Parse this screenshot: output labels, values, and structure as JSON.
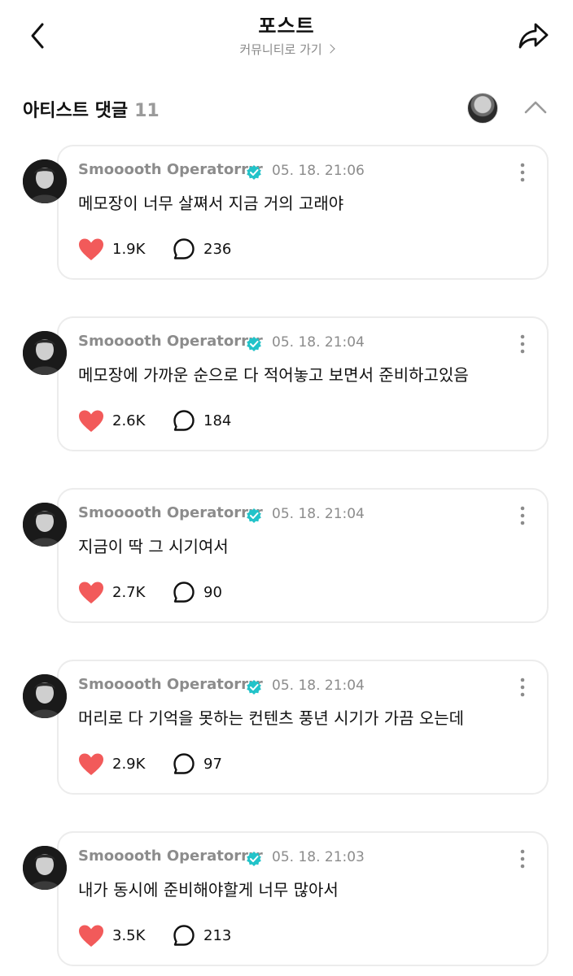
{
  "header": {
    "title": "포스트",
    "community_link": "커뮤니티로 가기",
    "icons": {
      "back": "chevron-left-icon",
      "share": "share-icon",
      "community_chevron": "chevron-right-icon"
    }
  },
  "section": {
    "title": "아티스트 댓글",
    "count": "11",
    "collapse_icon": "chevron-up-icon"
  },
  "colors": {
    "heart": "#f25a5a",
    "verified": "#22c3c9",
    "meta_text": "#8c8c8c",
    "card_border": "#ececec"
  },
  "comments": [
    {
      "author": "Smooooth Operatorrrr",
      "time": "05. 18. 21:06",
      "text": "메모장이 너무 살쪄서 지금 거의 고래야",
      "likes": "1.9K",
      "replies": "236"
    },
    {
      "author": "Smooooth Operatorrrr",
      "time": "05. 18. 21:04",
      "text": "메모장에 가까운 순으로 다 적어놓고 보면서 준비하고있음",
      "likes": "2.6K",
      "replies": "184"
    },
    {
      "author": "Smooooth Operatorrrr",
      "time": "05. 18. 21:04",
      "text": "지금이 딱 그 시기여서",
      "likes": "2.7K",
      "replies": "90"
    },
    {
      "author": "Smooooth Operatorrrr",
      "time": "05. 18. 21:04",
      "text": "머리로 다 기억을 못하는 컨텐츠 풍년 시기가 가끔 오는데",
      "likes": "2.9K",
      "replies": "97"
    },
    {
      "author": "Smooooth Operatorrrr",
      "time": "05. 18. 21:03",
      "text": "내가 동시에 준비해야할게 너무 많아서",
      "likes": "3.5K",
      "replies": "213"
    }
  ]
}
